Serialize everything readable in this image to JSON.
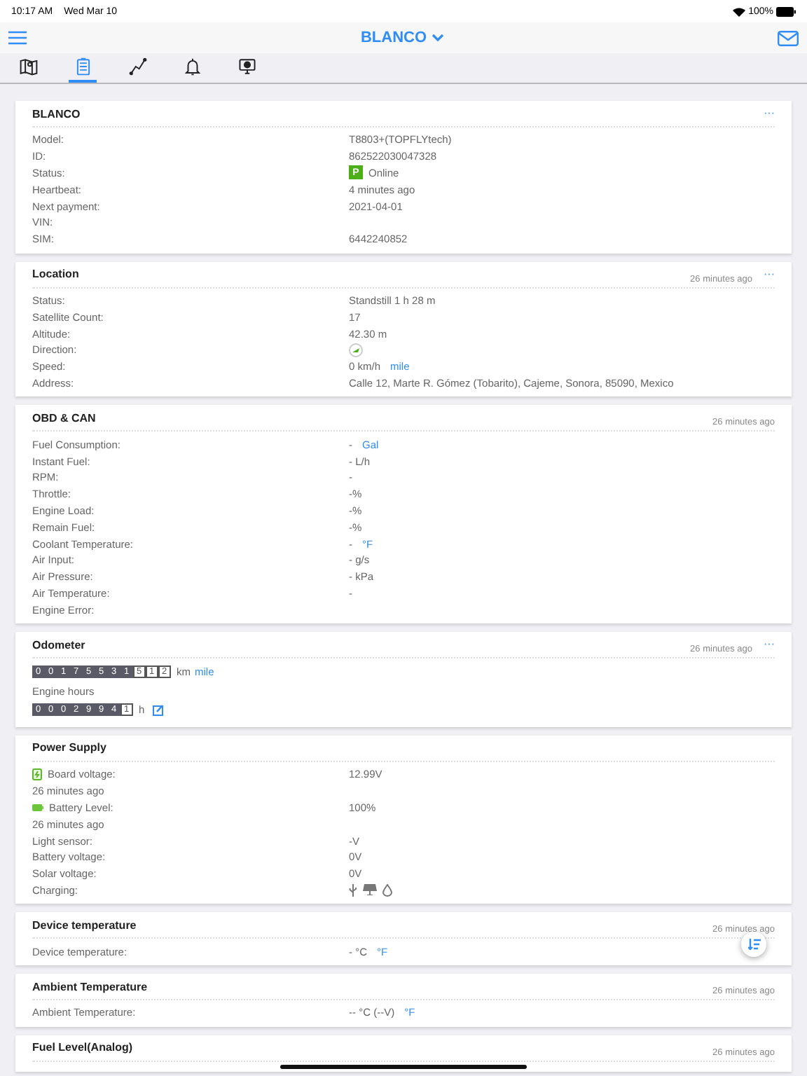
{
  "status_bar": {
    "time": "10:17 AM",
    "date": "Wed Mar 10",
    "battery": "100%"
  },
  "nav": {
    "title": "BLANCO"
  },
  "tabs": [
    {
      "kind": "map",
      "selected": false
    },
    {
      "kind": "list",
      "selected": true
    },
    {
      "kind": "chart",
      "selected": false
    },
    {
      "kind": "bell",
      "selected": false
    },
    {
      "kind": "monitor",
      "selected": false
    }
  ],
  "cards": [
    {
      "kind": "rows",
      "title": "BLANCO",
      "more": "···",
      "rows": [
        {
          "label": "Model:",
          "value": "T8803+(TOPFLYtech)"
        },
        {
          "label": "ID:",
          "value": "862522030047328"
        },
        {
          "label": "Status:",
          "badge": "P",
          "value": "Online"
        },
        {
          "label": "Heartbeat:",
          "value": "4 minutes ago"
        },
        {
          "label": "Next payment:",
          "value": "2021-04-01"
        },
        {
          "label": "VIN:"
        },
        {
          "label": "SIM:",
          "value": "6442240852"
        }
      ]
    },
    {
      "kind": "rows",
      "title": "Location",
      "time": "26 minutes ago",
      "more": "···",
      "rows": [
        {
          "label": "Status:",
          "value": "Standstill 1 h 28 m"
        },
        {
          "label": "Satellite Count:",
          "value": "17"
        },
        {
          "label": "Altitude:",
          "value": "42.30 m"
        },
        {
          "label": "Direction:",
          "kind": "direction"
        },
        {
          "label": "Speed:",
          "value": "0 km/h",
          "link": "mile"
        },
        {
          "label": "Address:",
          "value": "Calle 12, Marte R. Gómez (Tobarito), Cajeme, Sonora, 85090, Mexico"
        }
      ]
    },
    {
      "kind": "rows",
      "title": "OBD & CAN",
      "time": "26 minutes ago",
      "rows": [
        {
          "label": "Fuel Consumption:",
          "value": "-",
          "link": "Gal"
        },
        {
          "label": "Instant Fuel:",
          "value": "- L/h"
        },
        {
          "label": "RPM:",
          "value": "-"
        },
        {
          "label": "Throttle:",
          "value": "-%"
        },
        {
          "label": "Engine Load:",
          "value": "-%"
        },
        {
          "label": "Remain Fuel:",
          "value": "-%"
        },
        {
          "label": "Coolant Temperature:",
          "value": "-",
          "link": "°F"
        },
        {
          "label": "Air Input:",
          "value": "- g/s"
        },
        {
          "label": "Air Pressure:",
          "value": "- kPa"
        },
        {
          "label": "Air Temperature:",
          "value": "-"
        },
        {
          "label": "Engine Error:"
        }
      ]
    },
    {
      "kind": "odometer",
      "title": "Odometer",
      "time": "26 minutes ago",
      "more": "···",
      "odometer": {
        "integer": [
          "0",
          "0",
          "1",
          "7",
          "5",
          "5",
          "3",
          "1"
        ],
        "decimal": [
          "5",
          "1",
          "2"
        ],
        "unit": "km",
        "link": "mile"
      },
      "hours_label": "Engine hours",
      "hours": {
        "integer": [
          "0",
          "0",
          "0",
          "2",
          "9",
          "9",
          "4"
        ],
        "decimal": [
          "1"
        ],
        "unit": "h"
      }
    },
    {
      "kind": "rows",
      "title": "Power Supply",
      "rows": [
        {
          "label": "Board voltage:",
          "kind": "board",
          "value": "12.99V",
          "note": "26 minutes ago"
        },
        {
          "label": "Battery Level:",
          "kind": "battery",
          "value": "100%",
          "note": "26 minutes ago"
        },
        {
          "label": "Light sensor:",
          "value": "-V"
        },
        {
          "label": "Battery voltage:",
          "value": "0V"
        },
        {
          "label": "Solar voltage:",
          "value": "0V"
        },
        {
          "label": "Charging:",
          "kind": "charging"
        }
      ]
    },
    {
      "kind": "rows",
      "title": "Device temperature",
      "time": "26 minutes ago",
      "rows": [
        {
          "label": "Device temperature:",
          "value": "- °C",
          "link": "°F"
        }
      ]
    },
    {
      "kind": "rows",
      "title": "Ambient Temperature",
      "time": "26 minutes ago",
      "rows": [
        {
          "label": "Ambient Temperature:",
          "value": "-- °C (--V)",
          "link": "°F"
        }
      ]
    },
    {
      "kind": "rows",
      "title": "Fuel Level(Analog)",
      "time": "26 minutes ago"
    }
  ]
}
